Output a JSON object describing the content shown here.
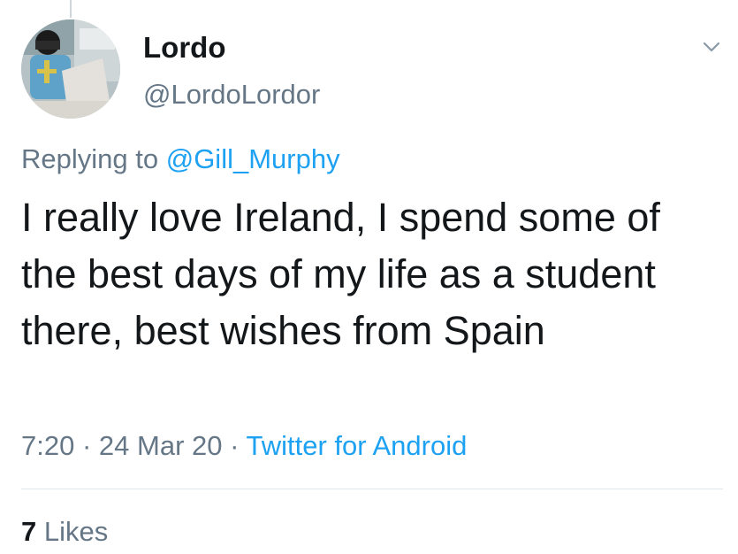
{
  "author": {
    "name": "Lordo",
    "handle": "@LordoLordor"
  },
  "reply": {
    "prefix": "Replying to",
    "mention": "@Gill_Murphy"
  },
  "tweet": {
    "text": "I really love Ireland, I spend some of the best days of my life as a student there, best wishes from Spain"
  },
  "meta": {
    "time": "7:20",
    "separator": "·",
    "date": "24 Mar 20",
    "source": "Twitter for Android"
  },
  "stats": {
    "likes_count": "7",
    "likes_label": "Likes"
  },
  "icons": {
    "menu": "chevron-down-icon"
  },
  "colors": {
    "text_primary": "#14171a",
    "text_secondary": "#657786",
    "link": "#1da1f2",
    "divider": "#e1e8ed"
  }
}
